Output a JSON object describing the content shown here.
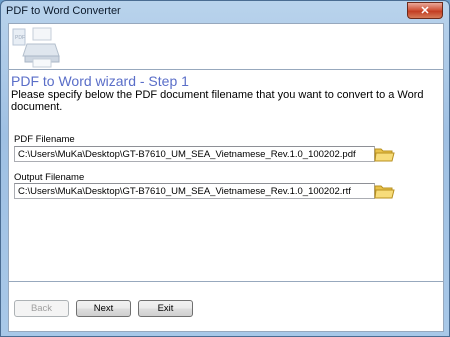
{
  "window": {
    "title": "PDF to Word Converter",
    "close_label": "✕"
  },
  "wizard": {
    "title": "PDF to Word wizard - Step 1",
    "description": "Please specify below the PDF document filename that you want to convert to a Word document."
  },
  "pdf_field": {
    "label": "PDF Filename",
    "value": "C:\\Users\\MuKa\\Desktop\\GT-B7610_UM_SEA_Vietnamese_Rev.1.0_100202.pdf"
  },
  "output_field": {
    "label": "Output Filename",
    "value": "C:\\Users\\MuKa\\Desktop\\GT-B7610_UM_SEA_Vietnamese_Rev.1.0_100202.rtf"
  },
  "buttons": {
    "back": "Back",
    "next": "Next",
    "exit": "Exit"
  },
  "icons": {
    "banner": "printer-icon",
    "browse": "folder-icon"
  },
  "colors": {
    "wizard_title": "#5a6ec8",
    "window_frame": "#a8c8e8",
    "close_button": "#c23d22"
  }
}
